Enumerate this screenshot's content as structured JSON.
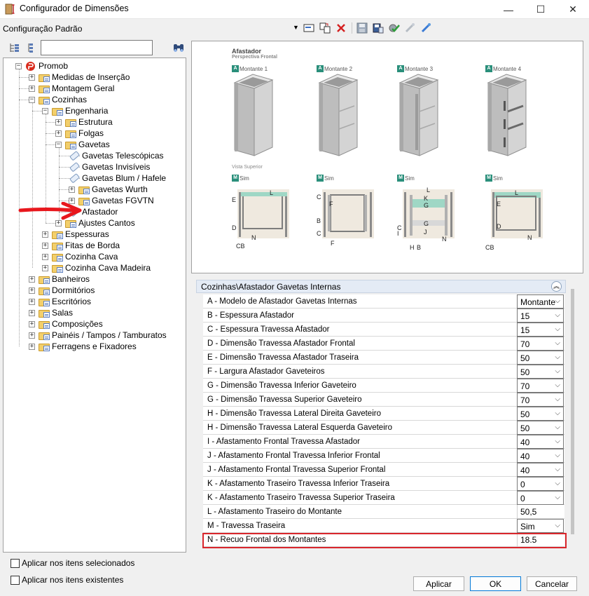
{
  "window": {
    "title": "Configurador de Dimensões",
    "minimize": "—",
    "maximize": "☐",
    "close": "✕"
  },
  "config": {
    "name": "Configuração Padrão"
  },
  "search": {
    "value": ""
  },
  "tree": {
    "root": "Promob",
    "items": [
      "Medidas de Inserção",
      "Montagem Geral",
      "Cozinhas",
      "Engenharia",
      "Estrutura",
      "Folgas",
      "Gavetas",
      "Gavetas Telescópicas",
      "Gavetas Invisíveis",
      "Gavetas Blum / Hafele",
      "Gavetas Wurth",
      "Gavetas FGVTN",
      "Afastador",
      "Ajustes Cantos",
      "Espessuras",
      "Fitas de Borda",
      "Cozinha Cava",
      "Cozinha Cava Madeira",
      "Banheiros",
      "Dormitórios",
      "Escritórios",
      "Salas",
      "Composições",
      "Painéis / Tampos / Tamburatos",
      "Ferragens e Fixadores"
    ]
  },
  "preview": {
    "title": "Afastador",
    "subtitle": "Perspectiva Frontal",
    "top_label": "Vista Superior",
    "montantes": [
      {
        "letter": "A",
        "label": "Montante 1"
      },
      {
        "letter": "A",
        "label": "Montante 2"
      },
      {
        "letter": "A",
        "label": "Montante 3"
      },
      {
        "letter": "A",
        "label": "Montante 4"
      }
    ],
    "sims": [
      {
        "letter": "M",
        "label": "Sim"
      },
      {
        "letter": "M",
        "label": "Sim"
      },
      {
        "letter": "M",
        "label": "Sim"
      },
      {
        "letter": "M",
        "label": "Sim"
      }
    ],
    "dims": {
      "L": "L",
      "E": "E",
      "D": "D",
      "N": "N",
      "CB": "CB",
      "C": "C",
      "F": "F",
      "B": "B",
      "K": "K",
      "G": "G",
      "I": "I",
      "J": "J",
      "H": "H"
    }
  },
  "properties": {
    "header": "Cozinhas\\Afastador Gavetas Internas",
    "rows": [
      {
        "label": "A - Modelo de Afastador Gavetas Internas",
        "value": "Montante"
      },
      {
        "label": "B - Espessura Afastador",
        "value": "15"
      },
      {
        "label": "C - Espessura Travessa Afastador",
        "value": "15"
      },
      {
        "label": "D - Dimensão Travessa Afastador Frontal",
        "value": "70"
      },
      {
        "label": "E - Dimensão Travessa Afastador Traseira",
        "value": "50"
      },
      {
        "label": "F - Largura Afastador Gaveteiros",
        "value": "50"
      },
      {
        "label": "G - Dimensão Travessa Inferior Gaveteiro",
        "value": "70"
      },
      {
        "label": "G - Dimensão Travessa Superior Gaveteiro",
        "value": "70"
      },
      {
        "label": "H - Dimensão Travessa Lateral Direita Gaveteiro",
        "value": "50"
      },
      {
        "label": "H - Dimensão Travessa Lateral Esquerda Gaveteiro",
        "value": "50"
      },
      {
        "label": "I - Afastamento Frontal Travessa Afastador",
        "value": "40"
      },
      {
        "label": "J - Afastamento Frontal Travessa Inferior Frontal",
        "value": "40"
      },
      {
        "label": "J - Afastamento Frontal Travessa Superior Frontal",
        "value": "40"
      },
      {
        "label": "K - Afastamento Traseiro Travessa Inferior Traseira",
        "value": "0"
      },
      {
        "label": "K - Afastamento Traseiro Travessa Superior Traseira",
        "value": "0"
      },
      {
        "label": "L - Afastamento Traseiro do Montante",
        "value": "50,5"
      },
      {
        "label": "M - Travessa Traseira",
        "value": "Sim"
      },
      {
        "label": "N - Recuo Frontal dos Montantes",
        "value": "18.5"
      }
    ]
  },
  "options": {
    "apply_selected": "Aplicar nos itens selecionados",
    "apply_existing": "Aplicar nos itens existentes"
  },
  "buttons": {
    "apply": "Aplicar",
    "ok": "OK",
    "cancel": "Cancelar"
  },
  "colors": {
    "accent": "#2a8f7b",
    "highlight": "#d9262c",
    "arrow": "#e8171d"
  }
}
